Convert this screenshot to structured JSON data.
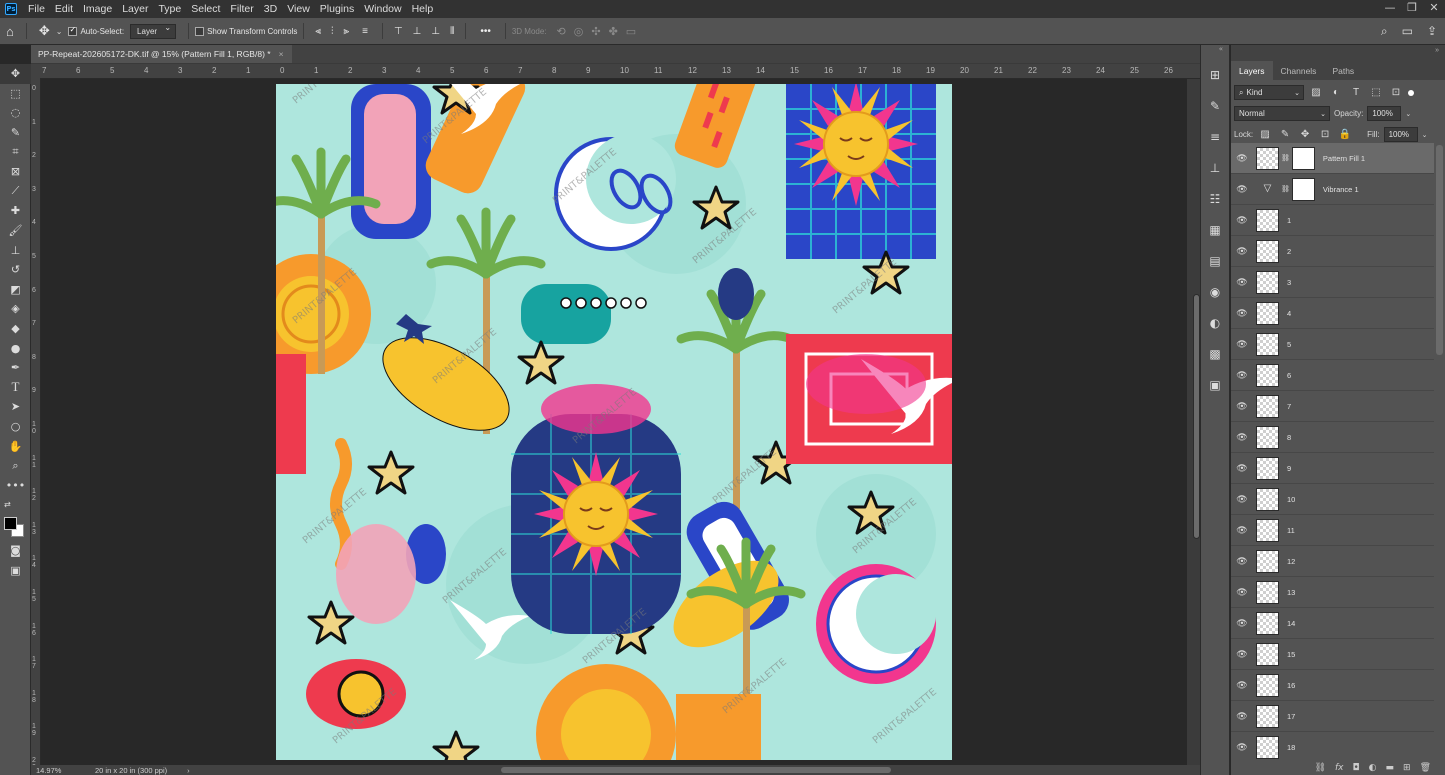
{
  "menubar": {
    "app_logo": "Ps",
    "items": [
      "File",
      "Edit",
      "Image",
      "Layer",
      "Type",
      "Select",
      "Filter",
      "3D",
      "View",
      "Plugins",
      "Window",
      "Help"
    ],
    "window_controls": [
      "—",
      "❐",
      "✕"
    ]
  },
  "options_bar": {
    "auto_select_label": "Auto-Select:",
    "auto_select_checked": true,
    "auto_select_target": "Layer",
    "show_transform_label": "Show Transform Controls",
    "mode_3d_label": "3D Mode:",
    "more_label": "•••"
  },
  "document": {
    "tab_title": "PP-Repeat-202605172-DK.tif @ 15% (Pattern Fill 1, RGB/8) *",
    "close_glyph": "×",
    "zoom": "14.97%",
    "doc_info": "20 in x 20 in (300 ppi)",
    "status_arrow": "›"
  },
  "ruler": {
    "h_labels": [
      "7",
      "6",
      "5",
      "4",
      "3",
      "2",
      "1",
      "0",
      "1",
      "2",
      "3",
      "4",
      "5",
      "6",
      "7",
      "8",
      "9",
      "10",
      "11",
      "12",
      "13",
      "14",
      "15",
      "16",
      "17",
      "18",
      "19",
      "20",
      "21",
      "22",
      "23",
      "24",
      "25",
      "26"
    ],
    "v_labels": [
      "0",
      "1",
      "2",
      "3",
      "4",
      "5",
      "6",
      "7",
      "8",
      "9",
      "1 0",
      "1 1",
      "1 2",
      "1 3",
      "1 4",
      "1 5",
      "1 6",
      "1 7",
      "1 8",
      "1 9",
      "2 0"
    ]
  },
  "artwork": {
    "watermark": "PRINT&PALETTE",
    "colors": {
      "bg": "#aee6dd",
      "sun": "#f7c32e",
      "pink": "#f2368e",
      "blue": "#2a46c8",
      "navy": "#253a84",
      "orange": "#f79a2c",
      "teal": "#17a3a0",
      "red": "#ee3a4e",
      "green": "#6fae4d",
      "star": "#f0d585"
    }
  },
  "layers_panel": {
    "tabs": [
      "Layers",
      "Channels",
      "Paths"
    ],
    "active_tab": "Layers",
    "filter_kind": "Kind",
    "blend_mode": "Normal",
    "opacity_label": "Opacity:",
    "opacity_value": "100%",
    "lock_label": "Lock:",
    "fill_label": "Fill:",
    "fill_value": "100%",
    "layers": [
      {
        "name": "Pattern Fill 1",
        "selected": true,
        "type": "fill"
      },
      {
        "name": "Vibrance 1",
        "selected": false,
        "type": "adjust"
      },
      {
        "name": "1"
      },
      {
        "name": "2"
      },
      {
        "name": "3"
      },
      {
        "name": "4"
      },
      {
        "name": "5"
      },
      {
        "name": "6"
      },
      {
        "name": "7"
      },
      {
        "name": "8"
      },
      {
        "name": "9"
      },
      {
        "name": "10"
      },
      {
        "name": "11"
      },
      {
        "name": "12"
      },
      {
        "name": "13"
      },
      {
        "name": "14"
      },
      {
        "name": "15"
      },
      {
        "name": "16"
      },
      {
        "name": "17"
      },
      {
        "name": "18"
      }
    ],
    "footer_icons": [
      "link-icon",
      "fx-icon",
      "mask-icon",
      "adjustment-icon",
      "group-icon",
      "new-layer-icon",
      "trash-icon"
    ]
  }
}
